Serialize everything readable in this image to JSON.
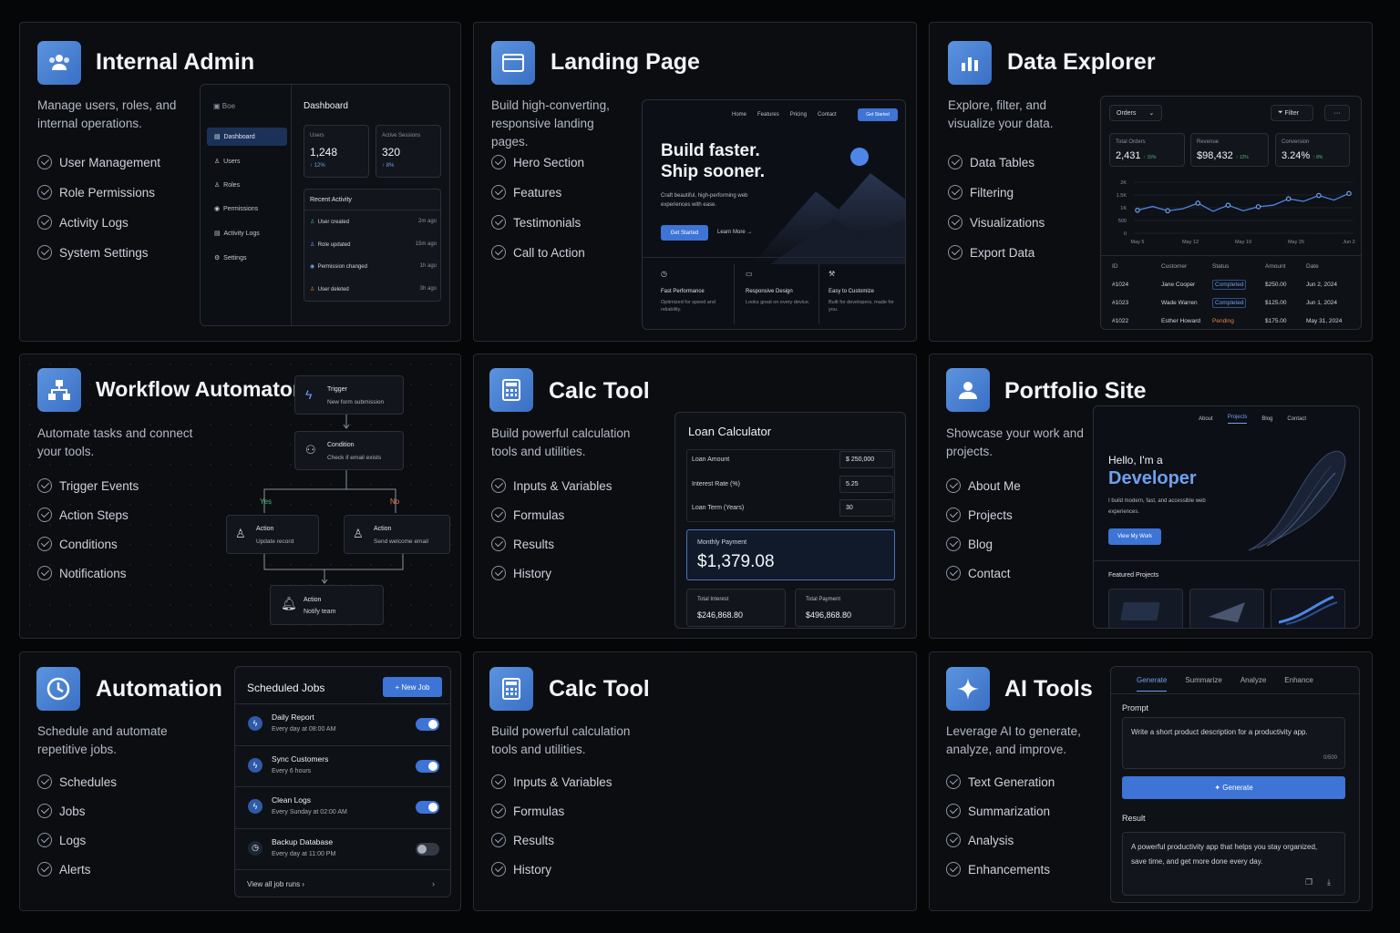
{
  "colors": {
    "accent": "#3d74d6",
    "bg": "#050608",
    "card": "#0b0d11",
    "green": "#4fb57a",
    "orange": "#e0814d"
  },
  "cards": {
    "admin": {
      "title": "Internal Admin",
      "icon": "users-icon",
      "desc": "Manage users, roles, and internal operations.",
      "features": [
        "User Management",
        "Role Permissions",
        "Activity Logs",
        "System Settings"
      ],
      "mock": {
        "logo": "Boe",
        "nav": [
          "Dashboard",
          "Users",
          "Roles",
          "Permissions",
          "Activity Logs",
          "Settings"
        ],
        "heading": "Dashboard",
        "stats": [
          {
            "label": "Users",
            "value": "1,248",
            "delta": "↑ 12%"
          },
          {
            "label": "Active Sessions",
            "value": "320",
            "delta": "↑ 8%"
          }
        ],
        "activity_title": "Recent Activity",
        "activity": [
          {
            "text": "User created",
            "time": "2m ago"
          },
          {
            "text": "Role updated",
            "time": "15m ago"
          },
          {
            "text": "Permission changed",
            "time": "1h ago"
          },
          {
            "text": "User deleted",
            "time": "3h ago"
          }
        ]
      }
    },
    "landing": {
      "title": "Landing Page",
      "icon": "browser-window-icon",
      "desc": "Build high-converting, responsive landing pages.",
      "features": [
        "Hero Section",
        "Features",
        "Testimonials",
        "Call to Action"
      ],
      "mock": {
        "nav": [
          "Home",
          "Features",
          "Pricing",
          "Contact"
        ],
        "cta": "Get Started",
        "headline1": "Build faster.",
        "headline2": "Ship sooner.",
        "sub": "Craft beautiful, high-performing web experiences with ease.",
        "btn": "Get Started",
        "learn": "Learn More →",
        "features": [
          {
            "icon": "gauge-icon",
            "title": "Fast Performance",
            "desc": "Optimized for speed and reliability."
          },
          {
            "icon": "monitor-icon",
            "title": "Responsive Design",
            "desc": "Looks great on every device."
          },
          {
            "icon": "tools-icon",
            "title": "Easy to Customize",
            "desc": "Built for developers, made for you."
          }
        ]
      }
    },
    "data": {
      "title": "Data Explorer",
      "icon": "bar-chart-icon",
      "desc": "Explore, filter, and visualize your data.",
      "features": [
        "Data Tables",
        "Filtering",
        "Visualizations",
        "Export Data"
      ],
      "mock": {
        "select": "Orders",
        "filter": "Filter",
        "more": "···",
        "stats": [
          {
            "label": "Total Orders",
            "value": "2,431",
            "delta": "↑ 15%"
          },
          {
            "label": "Revenue",
            "value": "$98,432",
            "delta": "↑ 12%"
          },
          {
            "label": "Conversion",
            "value": "3.24%",
            "delta": "↑ 8%"
          }
        ],
        "columns": [
          "ID",
          "Customer",
          "Status",
          "Amount",
          "Date"
        ],
        "rows": [
          [
            "#1024",
            "Jane Cooper",
            "Completed",
            "$250.00",
            "Jun 2, 2024"
          ],
          [
            "#1023",
            "Wade Warren",
            "Completed",
            "$125.00",
            "Jun 1, 2024"
          ],
          [
            "#1022",
            "Esther Howard",
            "Pending",
            "$175.00",
            "May 31, 2024"
          ]
        ]
      }
    },
    "workflow": {
      "title": "Workflow Automator",
      "icon": "workflow-icon",
      "desc": "Automate tasks and connect your tools.",
      "features": [
        "Trigger Events",
        "Action Steps",
        "Conditions",
        "Notifications"
      ],
      "mock": {
        "trigger": {
          "title": "Trigger",
          "sub": "New form submission"
        },
        "condition": {
          "title": "Condition",
          "sub": "Check if email exists"
        },
        "yes": "Yes",
        "no": "No",
        "action1": {
          "title": "Action",
          "sub": "Update record"
        },
        "action2": {
          "title": "Action",
          "sub": "Send welcome email"
        },
        "action3": {
          "title": "Action",
          "sub": "Notify team"
        }
      }
    },
    "calc": {
      "title": "Calc Tool",
      "icon": "calculator-icon",
      "desc": "Build powerful calculation tools and utilities.",
      "features": [
        "Inputs & Variables",
        "Formulas",
        "Results",
        "History"
      ],
      "mock": {
        "heading": "Loan Calculator",
        "fields": [
          {
            "label": "Loan Amount",
            "value": "$ 250,000"
          },
          {
            "label": "Interest Rate (%)",
            "value": "5.25"
          },
          {
            "label": "Loan Term (Years)",
            "value": "30"
          }
        ],
        "monthly_label": "Monthly Payment",
        "monthly": "$1,379.08",
        "interest_label": "Total Interest",
        "interest": "$246,868.80",
        "total_label": "Total Payment",
        "total": "$496,868.80"
      }
    },
    "portfolio": {
      "title": "Portfolio Site",
      "icon": "person-icon",
      "desc": "Showcase your work and projects.",
      "features": [
        "About Me",
        "Projects",
        "Blog",
        "Contact"
      ],
      "mock": {
        "nav": [
          "About",
          "Projects",
          "Blog",
          "Contact"
        ],
        "hello": "Hello, I'm a",
        "role": "Developer",
        "sub": "I build modern, fast, and accessible web experiences.",
        "btn": "View My Work",
        "featured": "Featured Projects"
      }
    },
    "automation": {
      "title": "Automation",
      "icon": "clock-icon",
      "desc": "Schedule and automate repetitive jobs.",
      "features": [
        "Schedules",
        "Jobs",
        "Logs",
        "Alerts"
      ],
      "mock": {
        "heading": "Scheduled Jobs",
        "new": "+ New Job",
        "jobs": [
          {
            "name": "Daily Report",
            "when": "Every day at 08:00 AM",
            "on": true
          },
          {
            "name": "Sync Customers",
            "when": "Every 6 hours",
            "on": true
          },
          {
            "name": "Clean Logs",
            "when": "Every Sunday at 02:00 AM",
            "on": true
          },
          {
            "name": "Backup Database",
            "when": "Every day at 11:00 PM",
            "on": false
          }
        ],
        "footer": "View all job runs ›"
      }
    },
    "calc2": {
      "title": "Calc Tool",
      "icon": "calculator-icon",
      "desc": "Build powerful calculation tools and utilities.",
      "features": [
        "Inputs & Variables",
        "Formulas",
        "Results",
        "History"
      ]
    },
    "ai": {
      "title": "AI Tools",
      "icon": "sparkle-icon",
      "desc": "Leverage AI to generate, analyze, and improve.",
      "features": [
        "Text Generation",
        "Summarization",
        "Analysis",
        "Enhancements"
      ],
      "mock": {
        "tabs": [
          "Generate",
          "Summarize",
          "Analyze",
          "Enhance"
        ],
        "prompt_label": "Prompt",
        "prompt": "Write a short product description for a productivity app.",
        "counter": "0/500",
        "btn": "✦ Generate",
        "result_label": "Result",
        "result": "A powerful productivity app that helps you stay organized, save time, and get more done every day."
      }
    }
  },
  "chart_data": {
    "type": "line",
    "x": [
      "May 5",
      "May 12",
      "May 19",
      "May 26",
      "Jun 2"
    ],
    "yticks": [
      "2K",
      "1.5K",
      "1K",
      "500",
      "0"
    ],
    "ylim": [
      0,
      2000
    ],
    "values": [
      900,
      1050,
      880,
      960,
      1180,
      860,
      1100,
      880,
      1040,
      1100,
      1350,
      1250,
      1480,
      1300,
      1560
    ]
  }
}
